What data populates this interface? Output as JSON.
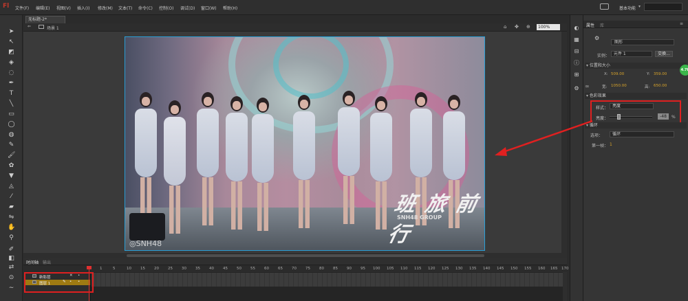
{
  "app": {
    "logo": "Fl",
    "workspace": "基本功能"
  },
  "menu": [
    "文件(F)",
    "编辑(E)",
    "视图(V)",
    "插入(I)",
    "修改(M)",
    "文本(T)",
    "命令(C)",
    "控制(O)",
    "调试(D)",
    "窗口(W)",
    "帮助(H)"
  ],
  "document": {
    "tab": "无标题-2*",
    "scene": "场景 1",
    "zoom": "100%"
  },
  "stage": {
    "logo_text": "班 旅 前 行",
    "logo_sub": "SNH48 GROUP",
    "watermark": "◎SNH48"
  },
  "timeline": {
    "tabs": [
      "时间轴",
      "输出"
    ],
    "layers": [
      {
        "name": "新影层"
      },
      {
        "name": "图层 1"
      }
    ],
    "frame_numbers": [
      "1",
      "5",
      "10",
      "15",
      "20",
      "25",
      "30",
      "35",
      "40",
      "45",
      "50",
      "55",
      "60",
      "65",
      "70",
      "75",
      "80",
      "85",
      "90",
      "95",
      "100",
      "105",
      "110",
      "115",
      "120",
      "125",
      "130",
      "135",
      "140",
      "145",
      "150",
      "155",
      "160",
      "165",
      "170"
    ]
  },
  "properties": {
    "tabs": [
      "属性",
      "库"
    ],
    "type_select": "图形",
    "instance_label": "实例：",
    "instance_value": "元件 1",
    "swap_button": "交换...",
    "sections": {
      "position": "位置和大小",
      "color": "色彩效果",
      "loop": "循环"
    },
    "x_label": "X:",
    "x_value": "509.00",
    "y_label": "Y:",
    "y_value": "359.00",
    "w_label": "宽:",
    "w_value": "1050.00",
    "h_label": "高:",
    "h_value": "650.00",
    "style_label": "样式：",
    "style_value": "亮度",
    "brightness_label": "亮度：",
    "brightness_value": "-48",
    "percent": "%",
    "options_label": "选项：",
    "options_value": "循环",
    "first_frame_label": "第一帧：",
    "first_frame_value": "1",
    "badge": "4.7K"
  }
}
